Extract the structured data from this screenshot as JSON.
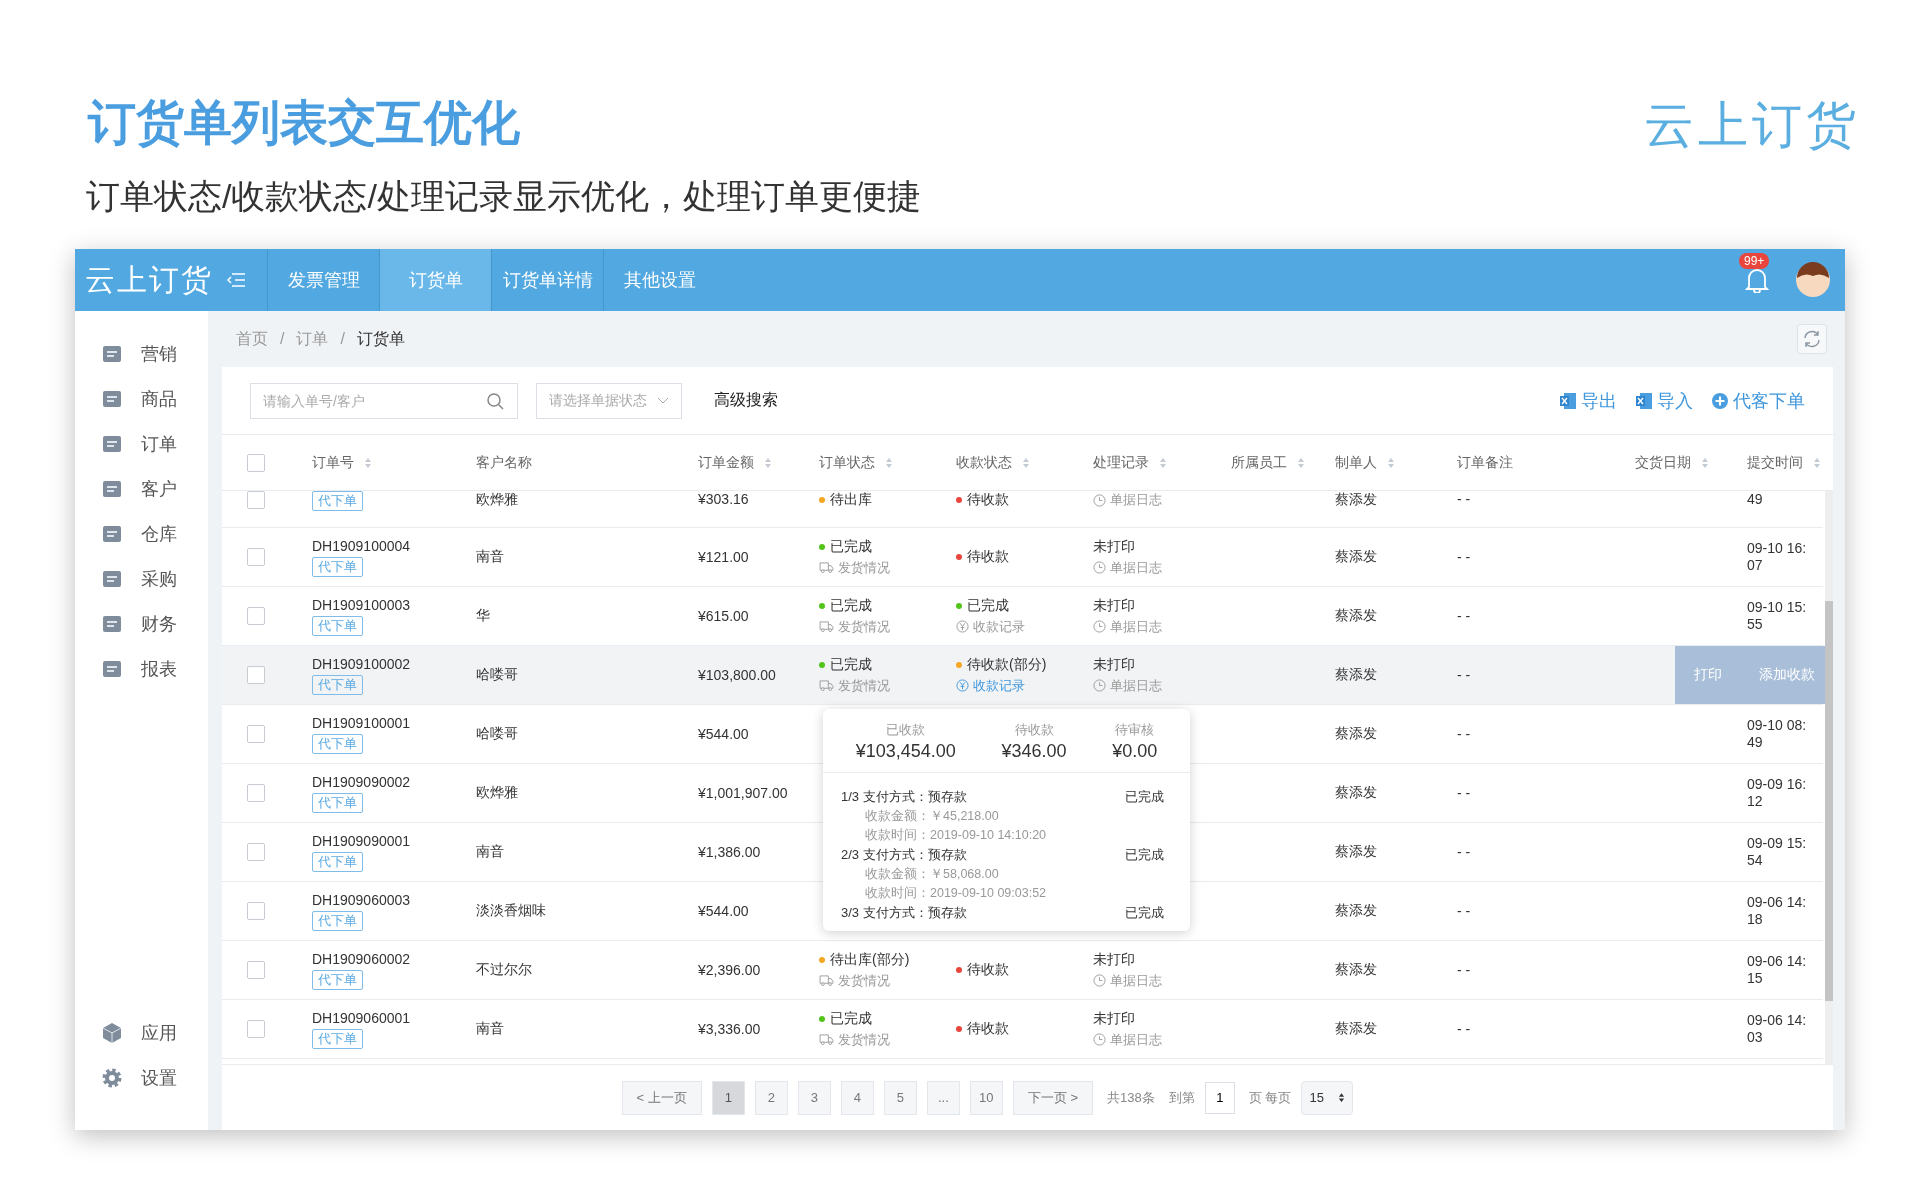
{
  "page": {
    "title": "订货单列表交互优化",
    "subtitle": "订单状态/收款状态/处理记录显示优化，处理订单更便捷",
    "brand": "云上订货"
  },
  "topbar": {
    "logo": "云上订货",
    "tabs": [
      {
        "label": "发票管理",
        "selected": false
      },
      {
        "label": "订货单",
        "selected": true
      },
      {
        "label": "订货单详情",
        "selected": false
      },
      {
        "label": "其他设置",
        "selected": false
      }
    ],
    "badge": "99+"
  },
  "sidebar": {
    "items": [
      "营销",
      "商品",
      "订单",
      "客户",
      "仓库",
      "采购",
      "财务",
      "报表"
    ],
    "bottom_items": [
      "应用",
      "设置"
    ]
  },
  "breadcrumb": {
    "items": [
      "首页",
      "订单",
      "订货单"
    ],
    "separator": "/"
  },
  "toolbar": {
    "search": {
      "placeholder": "请输入单号/客户"
    },
    "status_select": {
      "placeholder": "请选择单据状态"
    },
    "advanced": "高级搜索",
    "actions": [
      "导出",
      "导入",
      "代客下单"
    ]
  },
  "table": {
    "header_checked": false,
    "columns": [
      {
        "label": "订单号",
        "sortable": true
      },
      {
        "label": "客户名称",
        "sortable": false
      },
      {
        "label": "订单金额",
        "sortable": true
      },
      {
        "label": "订单状态",
        "sortable": true
      },
      {
        "label": "收款状态",
        "sortable": true
      },
      {
        "label": "处理记录",
        "sortable": true
      },
      {
        "label": "所属员工",
        "sortable": true
      },
      {
        "label": "制单人",
        "sortable": true
      },
      {
        "label": "订单备注",
        "sortable": false
      },
      {
        "label": "交货日期",
        "sortable": true
      },
      {
        "label": "提交时间",
        "sortable": true
      }
    ],
    "rows": [
      {
        "checked": false,
        "hovered": false,
        "tag": "代下单",
        "customer": "欧烨雅",
        "amount": "¥303.16",
        "order_status": {
          "text": "待出库",
          "color": "#f5a623"
        },
        "pay_status": {
          "text": "待收款",
          "color": "#e8463c"
        },
        "record": {
          "link": "单据日志"
        },
        "maker": "蔡添发",
        "remark": "- -",
        "time": "49"
      },
      {
        "checked": false,
        "hovered": false,
        "number": "DH1909100004",
        "tag": "代下单",
        "customer": "南音",
        "amount": "¥121.00",
        "order_status": {
          "text": "已完成",
          "color": "#52c41a",
          "link": "发货情况"
        },
        "pay_status": {
          "text": "待收款",
          "color": "#e8463c"
        },
        "record": {
          "text": "未打印",
          "link": "单据日志"
        },
        "maker": "蔡添发",
        "remark": "- -",
        "time": "09-10 16:07"
      },
      {
        "checked": false,
        "hovered": false,
        "number": "DH1909100003",
        "tag": "代下单",
        "customer": "华",
        "amount": "¥615.00",
        "order_status": {
          "text": "已完成",
          "color": "#52c41a",
          "link": "发货情况"
        },
        "pay_status": {
          "text": "已完成",
          "color": "#52c41a",
          "link": "收款记录",
          "link_active": false
        },
        "record": {
          "text": "未打印",
          "link": "单据日志"
        },
        "maker": "蔡添发",
        "remark": "- -",
        "time": "09-10 15:55"
      },
      {
        "checked": false,
        "hovered": true,
        "number": "DH1909100002",
        "tag": "代下单",
        "customer": "哈喽哥",
        "amount": "¥103,800.00",
        "order_status": {
          "text": "已完成",
          "color": "#52c41a",
          "link": "发货情况"
        },
        "pay_status": {
          "text": "待收款(部分)",
          "color": "#f5a623",
          "link": "收款记录",
          "link_active": true
        },
        "record": {
          "text": "未打印",
          "link": "单据日志"
        },
        "maker": "蔡添发",
        "remark": "- -",
        "actions": [
          "打印",
          "添加收款"
        ]
      },
      {
        "checked": false,
        "hovered": false,
        "number": "DH1909100001",
        "tag": "代下单",
        "customer": "哈喽哥",
        "amount": "¥544.00",
        "maker": "蔡添发",
        "remark": "- -",
        "time": "09-10 08:49"
      },
      {
        "checked": false,
        "hovered": false,
        "number": "DH1909090002",
        "tag": "代下单",
        "customer": "欧烨雅",
        "amount": "¥1,001,907.00",
        "maker": "蔡添发",
        "remark": "- -",
        "time": "09-09 16:12"
      },
      {
        "checked": false,
        "hovered": false,
        "number": "DH1909090001",
        "tag": "代下单",
        "customer": "南音",
        "amount": "¥1,386.00",
        "maker": "蔡添发",
        "remark": "- -",
        "time": "09-09 15:54"
      },
      {
        "checked": false,
        "hovered": false,
        "number": "DH1909060003",
        "tag": "代下单",
        "customer": "淡淡香烟味",
        "amount": "¥544.00",
        "maker": "蔡添发",
        "remark": "- -",
        "time": "09-06 14:18"
      },
      {
        "checked": false,
        "hovered": false,
        "number": "DH1909060002",
        "tag": "代下单",
        "customer": "不过尔尔",
        "amount": "¥2,396.00",
        "order_status": {
          "text": "待出库(部分)",
          "color": "#f5a623",
          "link": "发货情况"
        },
        "pay_status": {
          "text": "待收款",
          "color": "#e8463c"
        },
        "record": {
          "text": "未打印",
          "link": "单据日志"
        },
        "maker": "蔡添发",
        "remark": "- -",
        "time": "09-06 14:15"
      },
      {
        "checked": false,
        "hovered": false,
        "number": "DH1909060001",
        "tag": "代下单",
        "customer": "南音",
        "amount": "¥3,336.00",
        "order_status": {
          "text": "已完成",
          "color": "#52c41a",
          "link": "发货情况"
        },
        "pay_status": {
          "text": "待收款",
          "color": "#e8463c"
        },
        "record": {
          "text": "未打印",
          "link": "单据日志"
        },
        "maker": "蔡添发",
        "remark": "- -",
        "time": "09-06 14:03"
      }
    ]
  },
  "popover": {
    "summary": [
      {
        "label": "已收款",
        "value": "¥103,454.00"
      },
      {
        "label": "待收款",
        "value": "¥346.00"
      },
      {
        "label": "待审核",
        "value": "¥0.00"
      }
    ],
    "entries": [
      {
        "index": "1/3",
        "method": "支付方式：预存款",
        "status": "已完成",
        "lines": [
          "收款金额：￥45,218.00",
          "收款时间：2019-09-10 14:10:20"
        ]
      },
      {
        "index": "2/3",
        "method": "支付方式：预存款",
        "status": "已完成",
        "lines": [
          "收款金额：￥58,068.00",
          "收款时间：2019-09-10 09:03:52"
        ]
      },
      {
        "index": "3/3",
        "method": "支付方式：预存款",
        "status": "已完成"
      }
    ]
  },
  "pagination": {
    "prev": "< 上一页",
    "pages": [
      {
        "label": "1",
        "selected": true
      },
      {
        "label": "2",
        "selected": false
      },
      {
        "label": "3",
        "selected": false
      },
      {
        "label": "4",
        "selected": false
      },
      {
        "label": "5",
        "selected": false
      },
      {
        "label": "...",
        "selected": false
      },
      {
        "label": "10",
        "selected": false
      }
    ],
    "next": "下一页 >",
    "total": "共138条",
    "goto_label": "到第",
    "goto_value": "1",
    "per_page_label": "页 每页",
    "per_page": "15"
  }
}
